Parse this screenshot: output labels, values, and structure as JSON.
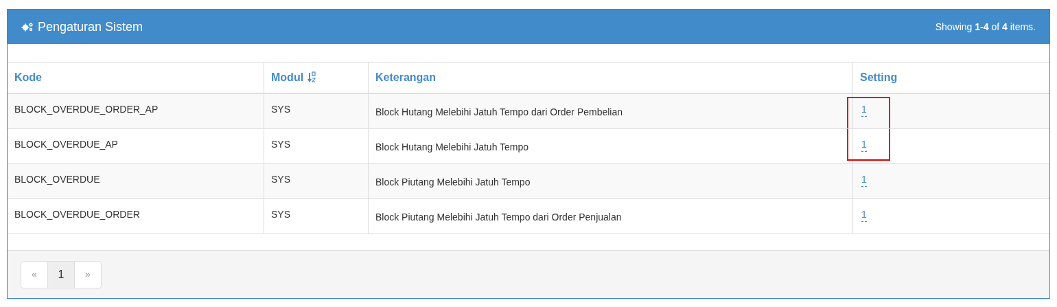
{
  "panel": {
    "title": "Pengaturan Sistem",
    "summary": "Showing **1-4** of **4** items."
  },
  "table": {
    "columns": [
      {
        "label": "Kode",
        "sorted": false
      },
      {
        "label": "Modul",
        "sorted": true
      },
      {
        "label": "Keterangan",
        "sorted": false
      },
      {
        "label": "Setting",
        "sorted": false
      }
    ],
    "rows": [
      {
        "kode": "BLOCK_OVERDUE_ORDER_AP",
        "modul": "SYS",
        "keterangan": "Block Hutang Melebihi Jatuh Tempo dari Order Pembelian",
        "setting": "1",
        "highlighted": true
      },
      {
        "kode": "BLOCK_OVERDUE_AP",
        "modul": "SYS",
        "keterangan": "Block Hutang Melebihi Jatuh Tempo",
        "setting": "1",
        "highlighted": true
      },
      {
        "kode": "BLOCK_OVERDUE",
        "modul": "SYS",
        "keterangan": "Block Piutang Melebihi Jatuh Tempo",
        "setting": "1",
        "highlighted": false
      },
      {
        "kode": "BLOCK_OVERDUE_ORDER",
        "modul": "SYS",
        "keterangan": "Block Piutang Melebihi Jatuh Tempo dari Order Penjualan",
        "setting": "1",
        "highlighted": false
      }
    ]
  },
  "pagination": [
    {
      "label": "«",
      "selected": false
    },
    {
      "label": "1",
      "selected": true
    },
    {
      "label": "»",
      "selected": false
    }
  ]
}
